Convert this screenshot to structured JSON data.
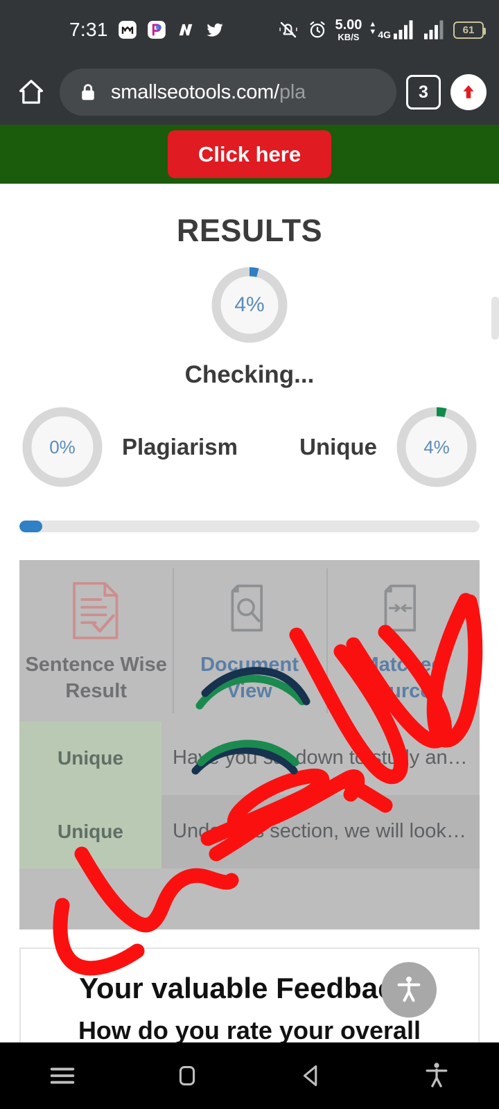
{
  "status_bar": {
    "time": "7:31",
    "app_icons": [
      "monzo-icon",
      "picsart-icon",
      "n-app-icon",
      "twitter-icon"
    ],
    "mute_icon": "bell-muted-icon",
    "alarm_icon": "alarm-clock-icon",
    "network_speed_value": "5.00",
    "network_speed_unit": "KB/S",
    "network_type": "4G",
    "signal_icon": "signal-bars-icon",
    "signal_icon_2": "signal-bars-secondary-icon",
    "battery_level": "61"
  },
  "browser": {
    "home_icon": "home-icon",
    "lock_icon": "lock-icon",
    "url_visible": "smallseotools.com/",
    "url_truncated": "pla",
    "tab_count": "3",
    "update_icon": "upload-arrow-icon"
  },
  "ad_banner": {
    "background_color": "#1a5c0c",
    "button_label": "Click here",
    "button_color": "#e01b22"
  },
  "results": {
    "title": "RESULTS",
    "main_gauge": {
      "value": "4%",
      "percent": 4,
      "arc_color": "#2f7fc4"
    },
    "status_text": "Checking...",
    "plagiarism": {
      "label": "Plagiarism",
      "value": "0%",
      "percent": 0,
      "arc_color": "#2f7fc4"
    },
    "unique": {
      "label": "Unique",
      "value": "4%",
      "percent": 4,
      "arc_color": "#0f8a4a"
    },
    "progress_percent": 4,
    "progress_color": "#2f80c4"
  },
  "panel": {
    "tabs": [
      {
        "label": "Sentence Wise Result",
        "icon": "document-check-icon",
        "state": "inactive",
        "color": "#6f7173"
      },
      {
        "label": "Document View",
        "icon": "document-search-icon",
        "state": "active",
        "color": "#5b7fa6"
      },
      {
        "label": "Matched Sources",
        "icon": "document-arrows-icon",
        "state": "active",
        "color": "#5b7fa6"
      }
    ],
    "rows": [
      {
        "badge": "Unique",
        "text": "Have you sat down to study an…"
      },
      {
        "badge": "Unique",
        "text": "Under this section, we will look…"
      }
    ]
  },
  "feedback": {
    "title": "Your valuable Feedback!",
    "subtitle": "How do you rate your overall"
  },
  "accessibility_fab": {
    "icon": "accessibility-person-icon"
  },
  "navbar": {
    "buttons": [
      {
        "name": "menu-icon",
        "label": "Menu"
      },
      {
        "name": "home-square-icon",
        "label": "Home"
      },
      {
        "name": "back-triangle-icon",
        "label": "Back"
      },
      {
        "name": "accessibility-person-icon",
        "label": "Accessibility"
      }
    ]
  },
  "annotations": {
    "description": "hand-drawn red marker scribbles over the results panel",
    "color": "#fb1010"
  }
}
